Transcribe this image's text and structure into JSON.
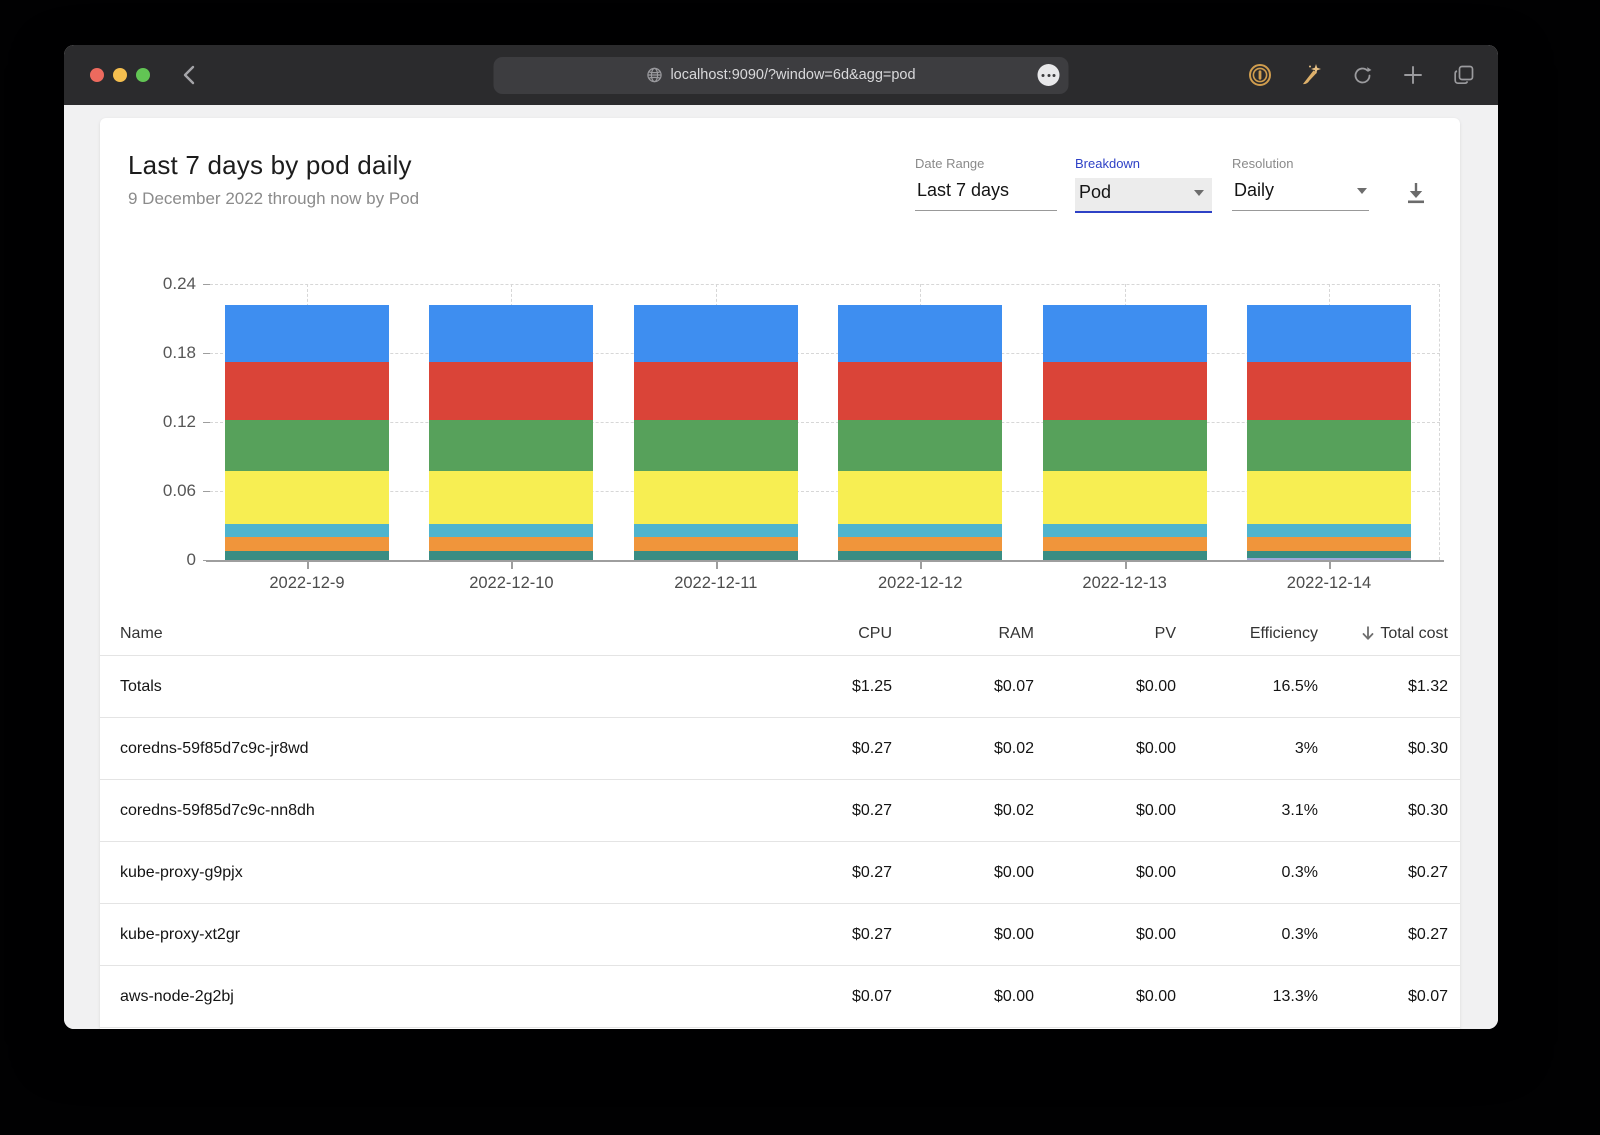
{
  "browser": {
    "url": "localhost:9090/?window=6d&agg=pod",
    "traffic_lights": {
      "close": "#ed6a5e",
      "minimize": "#f5bf4f",
      "zoom": "#62c554"
    },
    "icon_colors": {
      "extension_gold": "#d09d4e",
      "wand_gold": "#ddb06a",
      "toolbar_gray": "#9b9b9e"
    }
  },
  "header": {
    "title": "Last 7 days by pod daily",
    "subtitle": "9 December 2022 through now by Pod"
  },
  "controls": {
    "date_range": {
      "label": "Date Range",
      "value": "Last 7 days"
    },
    "breakdown": {
      "label": "Breakdown",
      "value": "Pod",
      "focused": true
    },
    "resolution": {
      "label": "Resolution",
      "value": "Daily"
    },
    "accent_color": "#2e41c6",
    "download_icon": "download-icon"
  },
  "chart_data": {
    "type": "bar",
    "stacked": true,
    "title": "",
    "xlabel": "",
    "ylabel": "",
    "ylim": [
      0,
      0.24
    ],
    "yticks": [
      0,
      0.06,
      0.12,
      0.18,
      0.24
    ],
    "grid": "dashed horizontal at yticks; dashed vertical at bar centers and right edge",
    "legend": "none",
    "categories": [
      "2022-12-9",
      "2022-12-10",
      "2022-12-11",
      "2022-12-12",
      "2022-12-13",
      "2022-12-14"
    ],
    "series": [
      {
        "name": "lavender-segment",
        "color": "#9fa8da",
        "values": [
          0,
          0,
          0,
          0,
          0,
          0.002
        ]
      },
      {
        "name": "teal-segment",
        "color": "#398d83",
        "values": [
          0.008,
          0.008,
          0.008,
          0.008,
          0.008,
          0.006
        ]
      },
      {
        "name": "orange-segment",
        "color": "#f0953b",
        "values": [
          0.012,
          0.012,
          0.012,
          0.012,
          0.012,
          0.012
        ]
      },
      {
        "name": "cyan-segment",
        "color": "#4fb4ce",
        "values": [
          0.011,
          0.011,
          0.011,
          0.011,
          0.011,
          0.011
        ]
      },
      {
        "name": "yellow-segment",
        "color": "#f7ee52",
        "values": [
          0.046,
          0.046,
          0.046,
          0.046,
          0.046,
          0.046
        ]
      },
      {
        "name": "green-segment",
        "color": "#57a15b",
        "values": [
          0.045,
          0.045,
          0.045,
          0.045,
          0.045,
          0.045
        ]
      },
      {
        "name": "red-segment",
        "color": "#da4438",
        "values": [
          0.05,
          0.05,
          0.05,
          0.05,
          0.05,
          0.05
        ]
      },
      {
        "name": "blue-segment",
        "color": "#3e8ef0",
        "values": [
          0.05,
          0.05,
          0.05,
          0.05,
          0.05,
          0.05
        ]
      }
    ]
  },
  "table": {
    "columns": [
      "Name",
      "CPU",
      "RAM",
      "PV",
      "Efficiency",
      "Total cost"
    ],
    "sort": {
      "column": "Total cost",
      "direction": "desc"
    },
    "rows": [
      [
        "Totals",
        "$1.25",
        "$0.07",
        "$0.00",
        "16.5%",
        "$1.32"
      ],
      [
        "coredns-59f85d7c9c-jr8wd",
        "$0.27",
        "$0.02",
        "$0.00",
        "3%",
        "$0.30"
      ],
      [
        "coredns-59f85d7c9c-nn8dh",
        "$0.27",
        "$0.02",
        "$0.00",
        "3.1%",
        "$0.30"
      ],
      [
        "kube-proxy-g9pjx",
        "$0.27",
        "$0.00",
        "$0.00",
        "0.3%",
        "$0.27"
      ],
      [
        "kube-proxy-xt2gr",
        "$0.27",
        "$0.00",
        "$0.00",
        "0.3%",
        "$0.27"
      ],
      [
        "aws-node-2g2bj",
        "$0.07",
        "$0.00",
        "$0.00",
        "13.3%",
        "$0.07"
      ]
    ]
  }
}
